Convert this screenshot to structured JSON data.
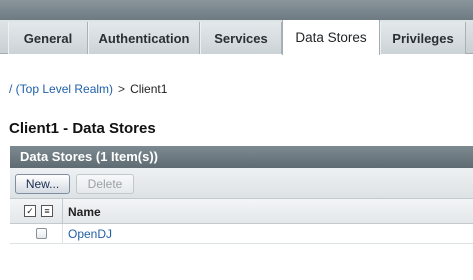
{
  "tabs": [
    {
      "label": "General",
      "active": false
    },
    {
      "label": "Authentication",
      "active": false
    },
    {
      "label": "Services",
      "active": false
    },
    {
      "label": "Data Stores",
      "active": true
    },
    {
      "label": "Privileges",
      "active": false
    }
  ],
  "breadcrumb": {
    "root_link": "/ (Top Level Realm)",
    "separator": ">",
    "current": "Client1"
  },
  "page_title": "Client1 - Data Stores",
  "panel": {
    "header": "Data Stores (1 Item(s))",
    "toolbar": {
      "new_label": "New...",
      "delete_label": "Delete"
    },
    "table": {
      "columns": [
        "Name"
      ],
      "rows": [
        {
          "name": "OpenDJ"
        }
      ]
    }
  },
  "icons": {
    "select_all": "select-all-icon",
    "deselect_all": "deselect-all-icon"
  }
}
